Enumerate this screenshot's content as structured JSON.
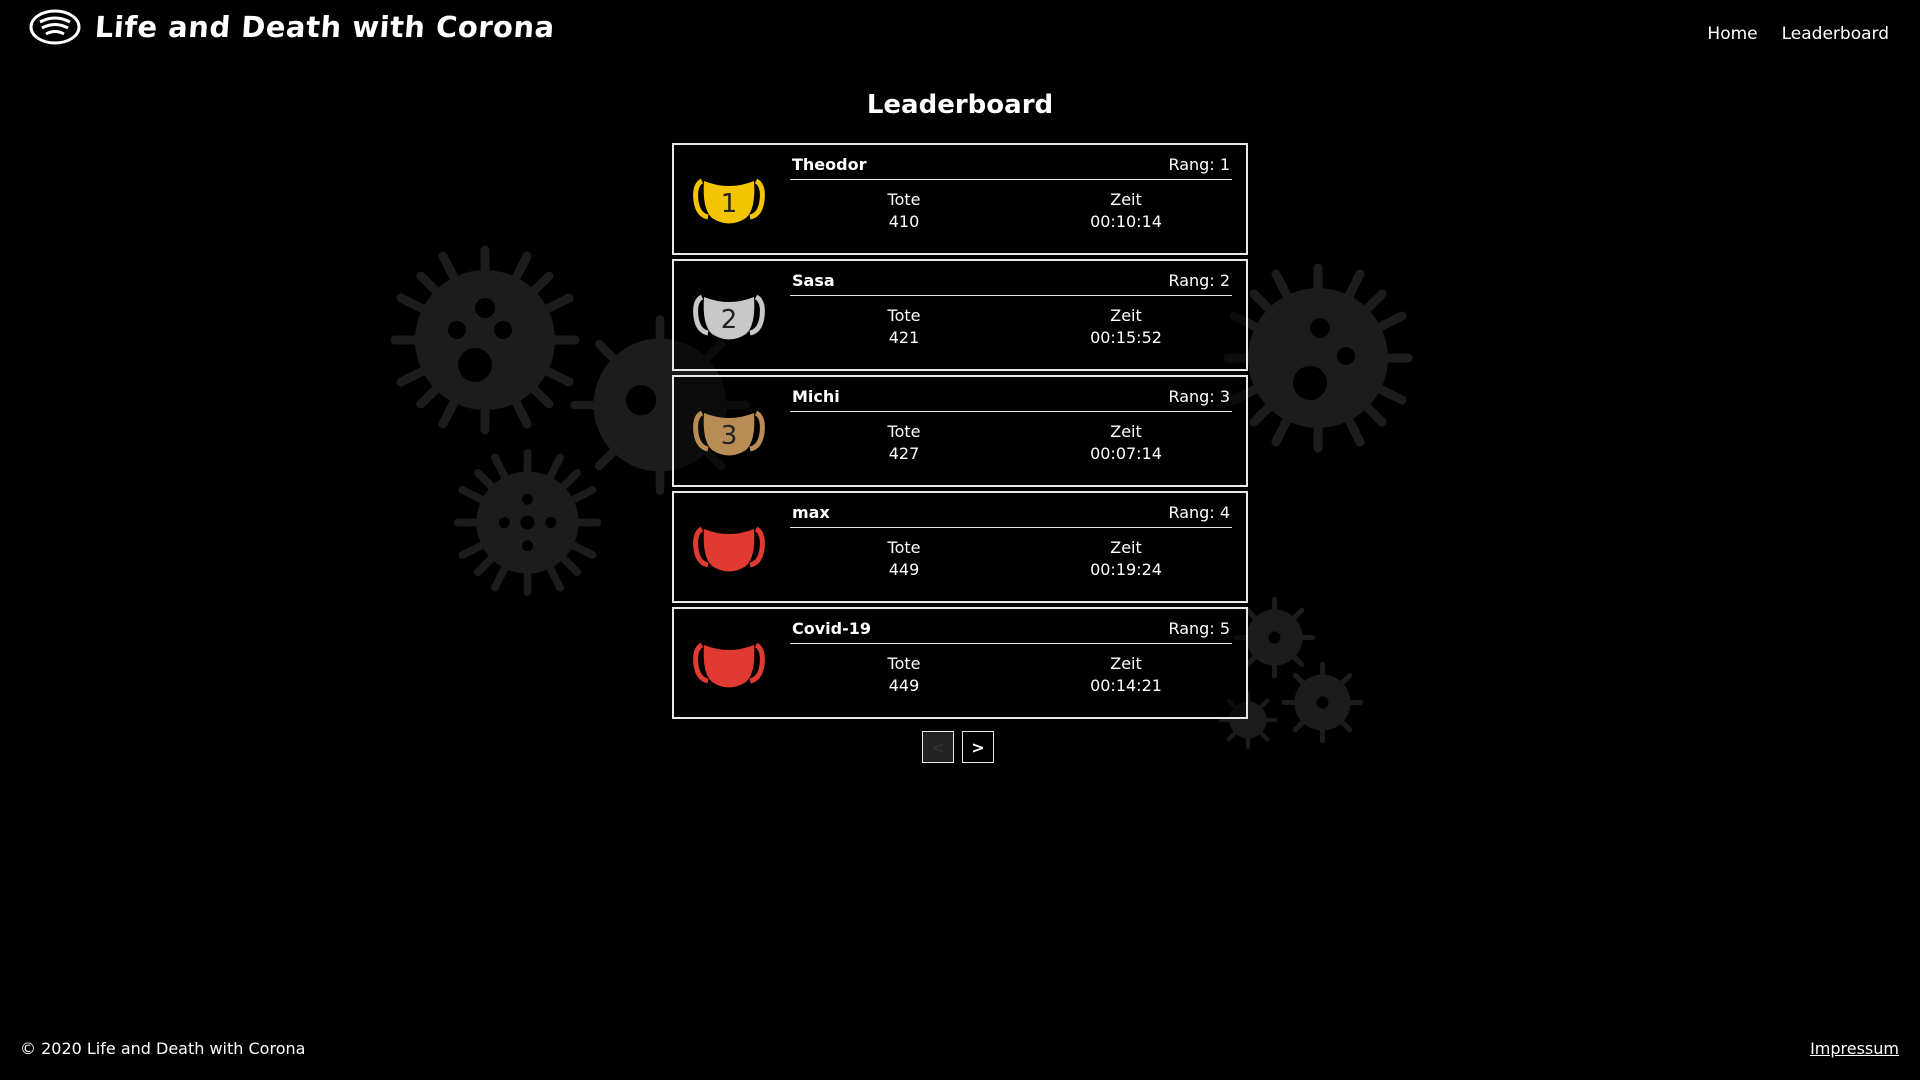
{
  "header": {
    "title": "Life and Death with Corona",
    "logo_icon": "face-mask-icon",
    "nav": [
      {
        "label": "Home"
      },
      {
        "label": "Leaderboard"
      }
    ]
  },
  "page": {
    "title": "Leaderboard"
  },
  "leaderboard": {
    "kills_label": "Tote",
    "time_label": "Zeit",
    "entries": [
      {
        "name": "Theodor",
        "rank": "Rang: 1",
        "kills": "410",
        "time": "00:10:14",
        "badge": "1",
        "mask_color": "#f5c400",
        "mask_icon": "gold-mask-icon"
      },
      {
        "name": "Sasa",
        "rank": "Rang: 2",
        "kills": "421",
        "time": "00:15:52",
        "badge": "2",
        "mask_color": "#c8c8c8",
        "mask_icon": "silver-mask-icon"
      },
      {
        "name": "Michi",
        "rank": "Rang: 3",
        "kills": "427",
        "time": "00:07:14",
        "badge": "3",
        "mask_color": "#b98c55",
        "mask_icon": "bronze-mask-icon"
      },
      {
        "name": "max",
        "rank": "Rang: 4",
        "kills": "449",
        "time": "00:19:24",
        "badge": "",
        "mask_color": "#e03a32",
        "mask_icon": "red-mask-icon"
      },
      {
        "name": "Covid-19",
        "rank": "Rang: 5",
        "kills": "449",
        "time": "00:14:21",
        "badge": "",
        "mask_color": "#e03a32",
        "mask_icon": "red-mask-icon"
      }
    ]
  },
  "pagination": {
    "prev_label": "<",
    "next_label": ">"
  },
  "footer": {
    "copyright": "© 2020 Life and Death with Corona",
    "impressum": "Impressum"
  },
  "colors": {
    "background": "#000000",
    "text": "#ffffff",
    "border": "#e8e8e8",
    "virus_bg": "#1c1c1c"
  }
}
